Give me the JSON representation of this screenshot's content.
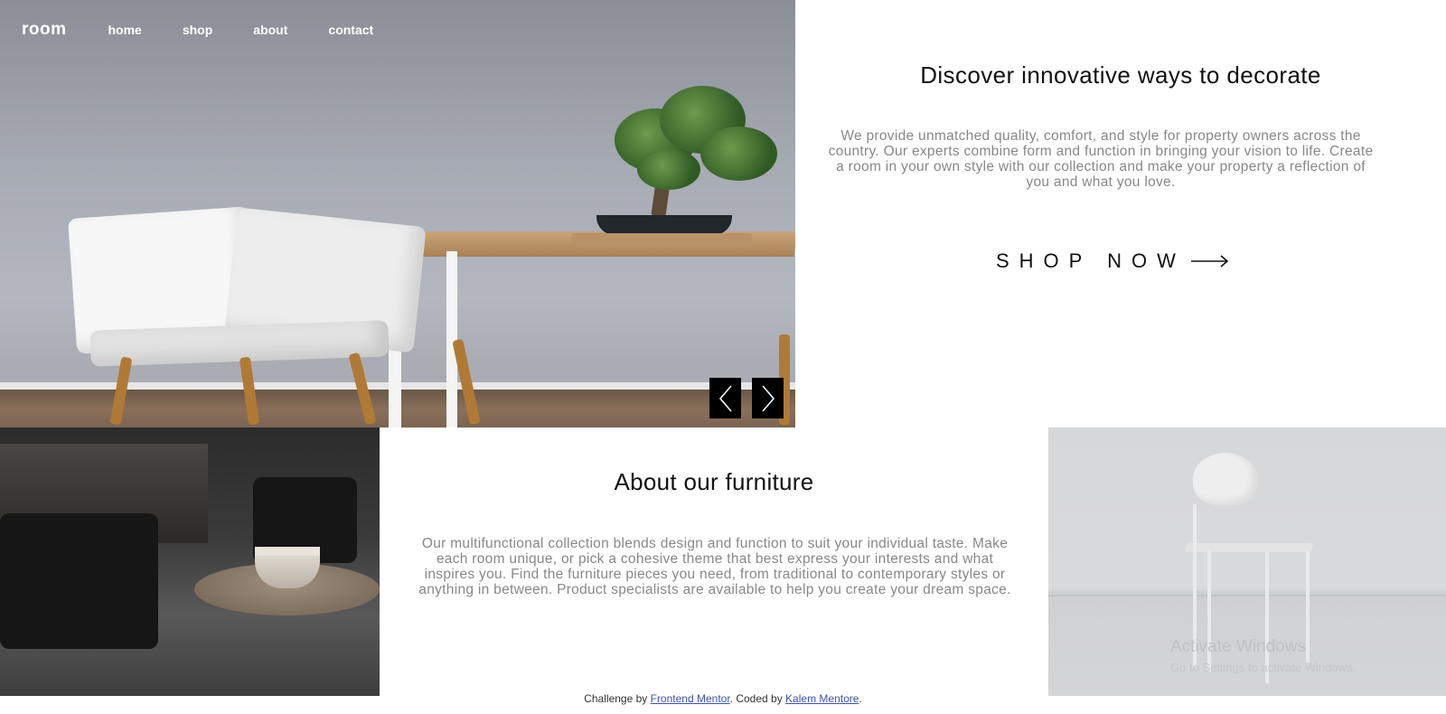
{
  "nav": {
    "logo": "room",
    "links": [
      "home",
      "shop",
      "about",
      "contact"
    ]
  },
  "hero": {
    "title": "Discover innovative ways to decorate",
    "description": "We provide unmatched quality, comfort, and style for property owners across the country. Our experts combine form and function in bringing your vision to life. Create a room in your own style with our collection and make your property a reflection of you and what you love.",
    "cta_label": "SHOP NOW",
    "prev_icon": "chevron-left-icon",
    "next_icon": "chevron-right-icon",
    "cta_icon": "arrow-right-icon"
  },
  "about": {
    "title": "About our furniture",
    "description": "Our multifunctional collection blends design and function to suit your individual taste. Make each room unique, or pick a cohesive theme that best express your interests and what inspires you. Find the furniture pieces you need, from traditional to contemporary styles or anything in between. Product specialists are available to help you create your dream space."
  },
  "watermark": {
    "title": "Activate Windows",
    "subtitle": "Go to Settings to activate Windows."
  },
  "footer": {
    "prefix": "Challenge by ",
    "frontend_mentor": "Frontend Mentor",
    "middle": ". Coded by ",
    "author": "Kalem Mentore",
    "suffix": "."
  },
  "colors": {
    "text_dark": "#111111",
    "text_muted": "#888888",
    "link": "#3e52a3",
    "button_bg": "#000000"
  }
}
